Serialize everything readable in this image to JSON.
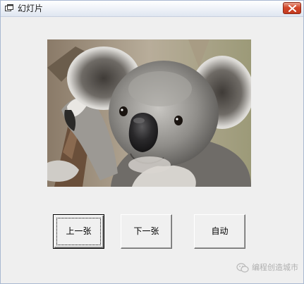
{
  "window": {
    "title": "幻灯片"
  },
  "picture": {
    "subject": "koala-photo"
  },
  "buttons": {
    "prev_label": "上一张",
    "next_label": "下一张",
    "auto_label": "自动"
  },
  "watermark": {
    "text": "编程创造城市"
  },
  "colors": {
    "window_bg": "#efefef",
    "close_button": "#d2472a",
    "titlebar_border": "#a9b8d1"
  },
  "icons": [
    "app-icon",
    "close-icon",
    "wechat-icon"
  ]
}
